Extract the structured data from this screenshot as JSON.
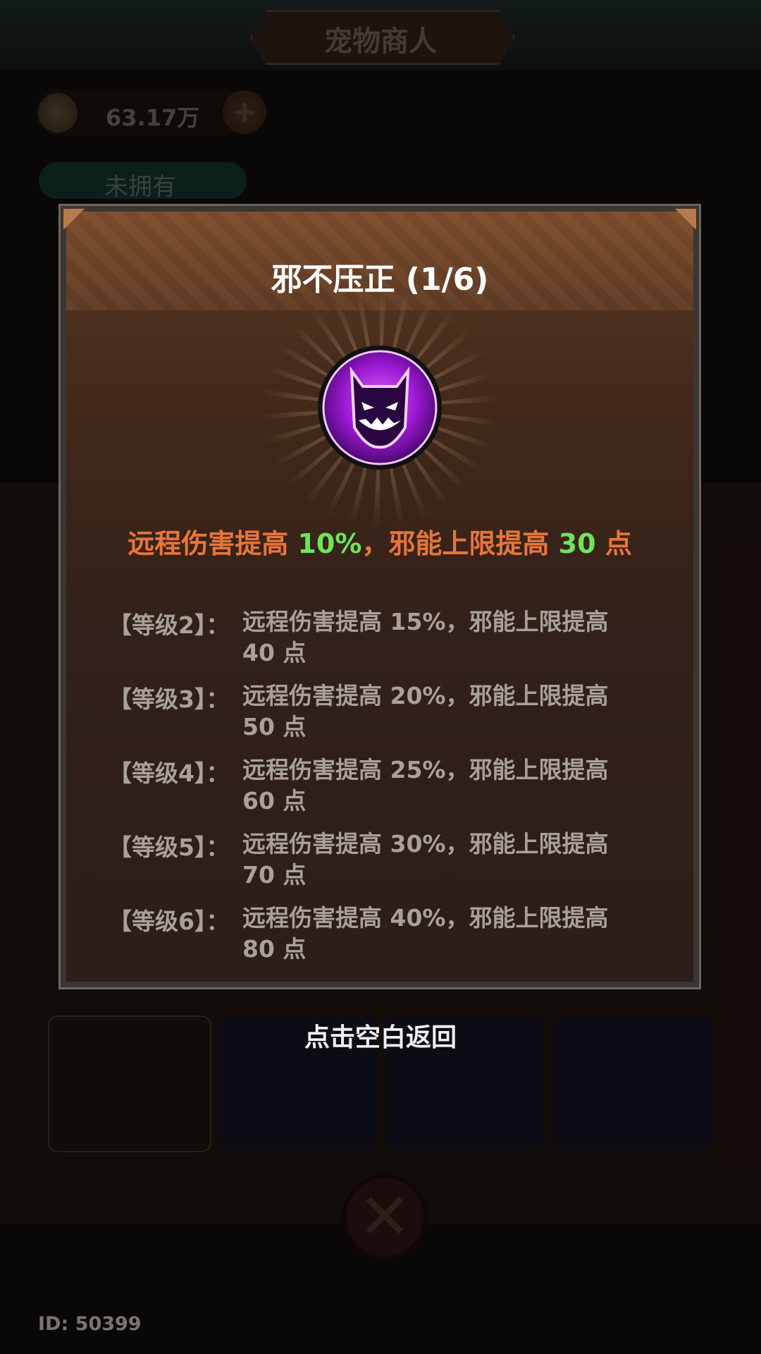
{
  "background": {
    "title": "宠物商人",
    "coins": "63.17万",
    "tab_label": "未拥有",
    "user_id": "ID: 50399"
  },
  "popup": {
    "title": "邪不压正 (1/6)",
    "summary": {
      "prefix": "远程伤害提高 ",
      "damage": "10%",
      "middle": "，邪能上限提高 ",
      "energy": "30",
      "suffix": " 点"
    },
    "levels": [
      {
        "tag": "【等级2】：",
        "line1": "远程伤害提高 15%，邪能上限提高",
        "line2": "40 点"
      },
      {
        "tag": "【等级3】：",
        "line1": "远程伤害提高 20%，邪能上限提高",
        "line2": "50 点"
      },
      {
        "tag": "【等级4】：",
        "line1": "远程伤害提高 25%，邪能上限提高",
        "line2": "60 点"
      },
      {
        "tag": "【等级5】：",
        "line1": "远程伤害提高 30%，邪能上限提高",
        "line2": "70 点"
      },
      {
        "tag": "【等级6】：",
        "line1": "远程伤害提高 40%，邪能上限提高",
        "line2": "80 点"
      }
    ],
    "icon": "demon-mask-icon"
  },
  "hint": "点击空白返回",
  "colors": {
    "accent_orange": "#e8743c",
    "value_green": "#6ee45a",
    "skill_purple": "#b020e0"
  }
}
